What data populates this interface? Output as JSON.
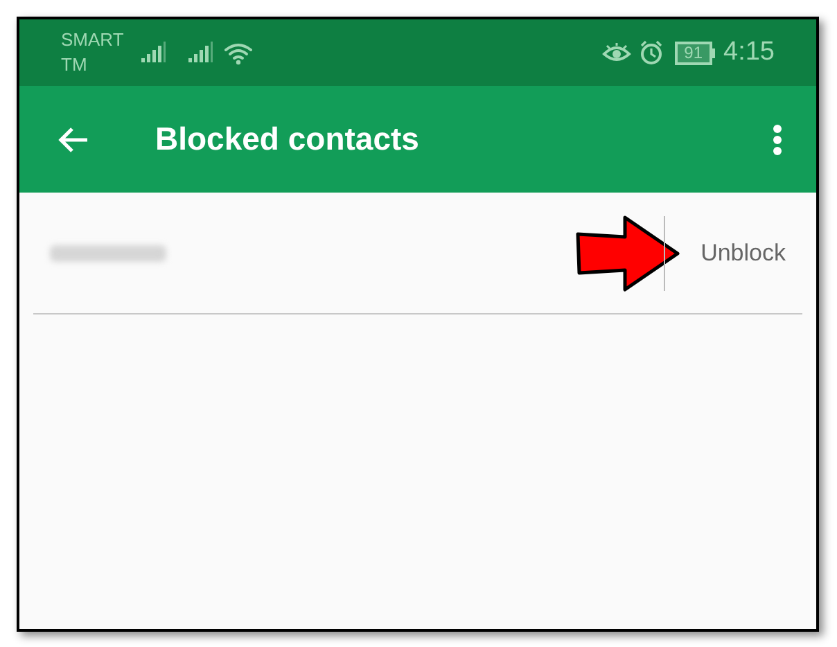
{
  "status_bar": {
    "carrier": "SMART TM",
    "battery": "91",
    "time": "4:15"
  },
  "app_bar": {
    "title": "Blocked contacts"
  },
  "contacts": [
    {
      "action": "Unblock",
      "redacted": true
    }
  ]
}
